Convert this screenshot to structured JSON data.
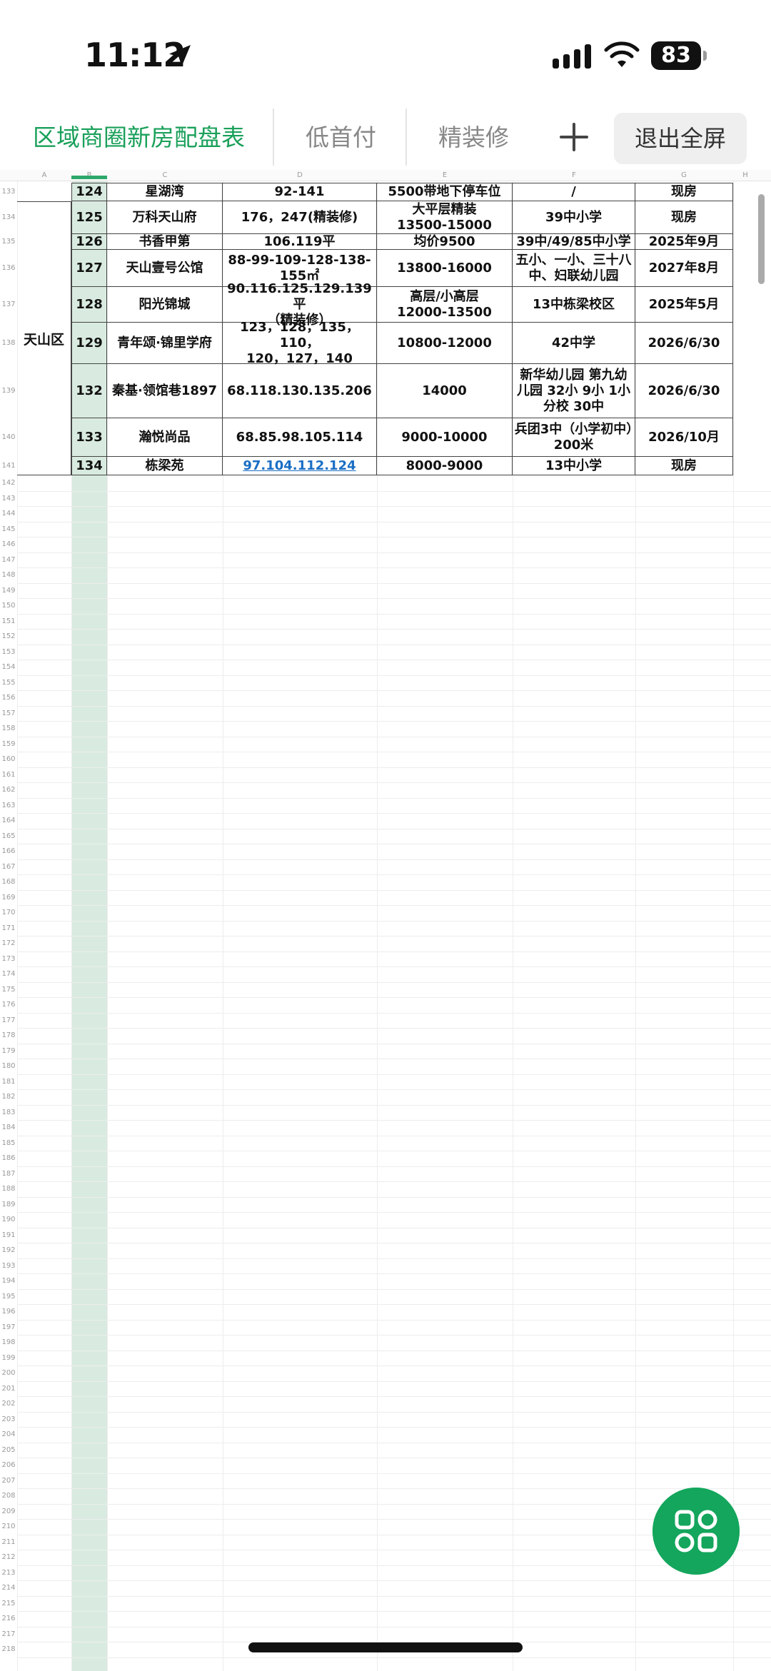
{
  "status_bar": {
    "time": "11:12",
    "battery": "83"
  },
  "tabs": [
    {
      "label": "区域商圈新房配盘表",
      "active": true
    },
    {
      "label": "低首付",
      "active": false
    },
    {
      "label": "精装修",
      "active": false
    }
  ],
  "exit_fullscreen_label": "退出全屏",
  "columns": [
    "A",
    "B",
    "C",
    "D",
    "E",
    "F",
    "G",
    "H"
  ],
  "district": "天山区",
  "rows": [
    {
      "row": 133,
      "no": "124",
      "name": "星湖湾",
      "area": "92-141",
      "price": "5500带地下停车位",
      "school": "/",
      "delivery": "现房"
    },
    {
      "row": 134,
      "no": "125",
      "name": "万科天山府",
      "area": "176，247(精装修)",
      "price": "大平层精装\n13500-15000",
      "school": "39中小学",
      "delivery": "现房"
    },
    {
      "row": 135,
      "no": "126",
      "name": "书香甲第",
      "area": "106.119平",
      "price": "均价9500",
      "school": "39中/49/85中小学",
      "delivery": "2025年9月"
    },
    {
      "row": 136,
      "no": "127",
      "name": "天山壹号公馆",
      "area": "88-99-109-128-138-155㎡",
      "price": "13800-16000",
      "school": "五小、一小、三十八中、妇联幼儿园",
      "delivery": "2027年8月"
    },
    {
      "row": 137,
      "no": "128",
      "name": "阳光锦城",
      "area": "90.116.125.129.139平\n（精装修）",
      "price": "高层/小高层\n12000-13500",
      "school": "13中栋梁校区",
      "delivery": "2025年5月"
    },
    {
      "row": 138,
      "no": "129",
      "name": "青年颂·锦里学府",
      "area": "123，128，135，110，\n120，127，140",
      "price": "10800-12000",
      "school": "42中学",
      "delivery": "2026/6/30"
    },
    {
      "row": 139,
      "no": "132",
      "name": "秦基·领馆巷1897",
      "area": "68.118.130.135.206",
      "price": "14000",
      "school": "新华幼儿园 第九幼儿园 32小 9小 1小分校 30中",
      "delivery": "2026/6/30"
    },
    {
      "row": 140,
      "no": "133",
      "name": "瀚悦尚品",
      "area": "68.85.98.105.114",
      "price": "9000-10000",
      "school": "兵团3中（小学初中）200米",
      "delivery": "2026/10月"
    },
    {
      "row": 141,
      "no": "134",
      "name": "栋梁苑",
      "area": "97.104.112.124",
      "price": "8000-9000",
      "school": "13中小学",
      "delivery": "现房"
    }
  ],
  "empty_rows_start": 142,
  "empty_rows_end": 218
}
